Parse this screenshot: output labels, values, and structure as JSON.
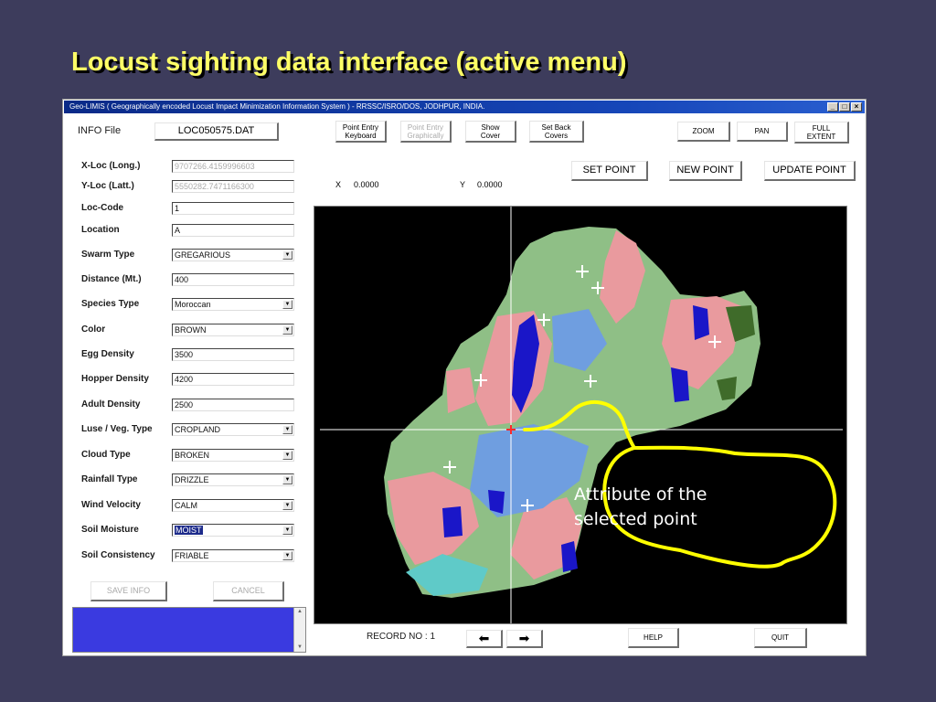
{
  "slide": {
    "title": "Locust sighting data interface (active menu)"
  },
  "window": {
    "title": "Geo-LIMIS ( Geographically encoded Locust Impact Minimization Information System ) - RRSSC/ISRO/DOS, JODHPUR, INDIA.",
    "controls": {
      "minimize": "_",
      "maximize": "□",
      "close": "×"
    }
  },
  "info_file": {
    "label": "INFO File",
    "value": "LOC050575.DAT"
  },
  "toolbar": {
    "point_entry_keyboard": "Point Entry\nKeyboard",
    "point_entry_graphically": "Point Entry\nGraphically",
    "show_cover": "Show\nCover",
    "set_back_covers": "Set Back\nCovers",
    "zoom": "ZOOM",
    "pan": "PAN",
    "full_extent": "FULL\nEXTENT"
  },
  "actions": {
    "set_point": "SET POINT",
    "new_point": "NEW POINT",
    "update_point": "UPDATE POINT"
  },
  "coords": {
    "x_label": "X",
    "x_value": "0.0000",
    "y_label": "Y",
    "y_value": "0.0000"
  },
  "form": [
    {
      "label": "X-Loc (Long.)",
      "value": "9707266.4159996603",
      "kind": "text",
      "dim": true
    },
    {
      "label": "Y-Loc (Latt.)",
      "value": "5550282.7471166300",
      "kind": "text",
      "dim": true
    },
    {
      "label": "Loc-Code",
      "value": "1",
      "kind": "text"
    },
    {
      "label": "Location",
      "value": "A",
      "kind": "text"
    },
    {
      "label": "Swarm Type",
      "value": "GREGARIOUS",
      "kind": "select"
    },
    {
      "label": "Distance (Mt.)",
      "value": "400",
      "kind": "text"
    },
    {
      "label": "Species Type",
      "value": "Moroccan",
      "kind": "select"
    },
    {
      "label": "Color",
      "value": "BROWN",
      "kind": "select"
    },
    {
      "label": "Egg Density",
      "value": "3500",
      "kind": "text"
    },
    {
      "label": "Hopper Density",
      "value": "4200",
      "kind": "text"
    },
    {
      "label": "Adult Density",
      "value": "2500",
      "kind": "text"
    },
    {
      "label": "Luse / Veg. Type",
      "value": "CROPLAND",
      "kind": "select"
    },
    {
      "label": "Cloud Type",
      "value": "BROKEN",
      "kind": "select"
    },
    {
      "label": "Rainfall Type",
      "value": "DRIZZLE",
      "kind": "select"
    },
    {
      "label": "Wind Velocity",
      "value": "CALM",
      "kind": "select"
    },
    {
      "label": "Soil Moisture",
      "value": "MOIST",
      "kind": "select",
      "selected": true
    },
    {
      "label": "Soil Consistency",
      "value": "FRIABLE",
      "kind": "select"
    }
  ],
  "form_buttons": {
    "save": "SAVE INFO",
    "cancel": "CANCEL"
  },
  "footer": {
    "record_label": "RECORD NO : 1",
    "prev": "⬅",
    "next": "➡",
    "help": "HELP",
    "quit": "QUIT"
  },
  "callout": {
    "text": "Attribute of the selected point"
  },
  "colors": {
    "background": "#3d3c5c",
    "title": "#ffff66",
    "map_background": "#000000",
    "callout_outline": "#ffff00",
    "info_box": "#3a3ae0"
  }
}
